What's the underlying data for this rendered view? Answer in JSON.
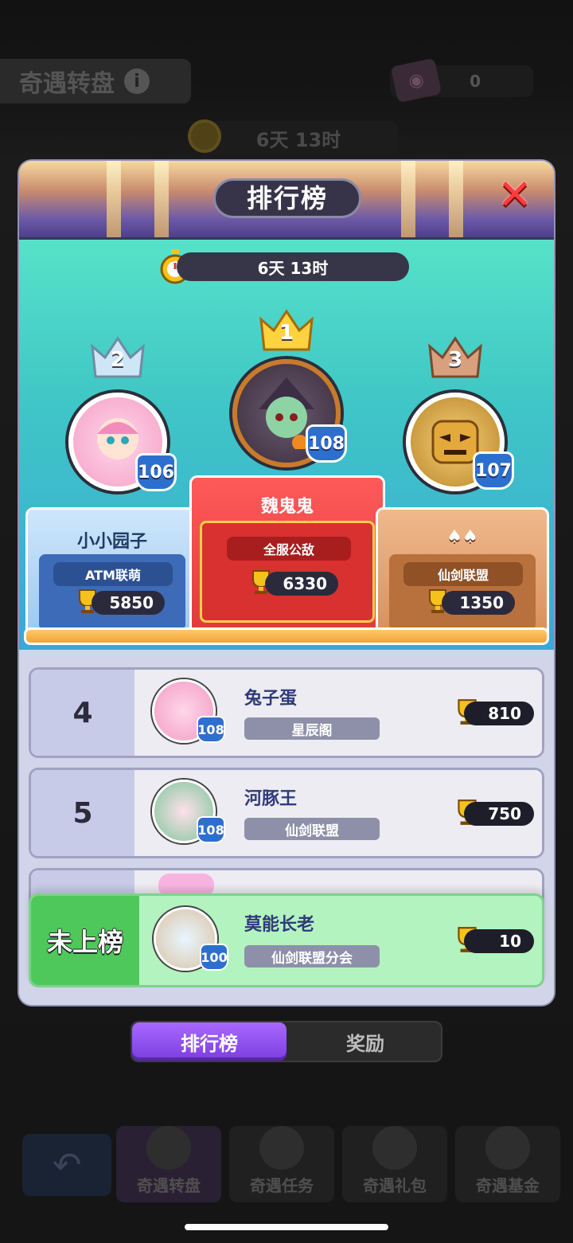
{
  "background": {
    "title": "奇遇转盘",
    "ticket_count": "0",
    "timer": "6天 13时"
  },
  "modal": {
    "title": "排行榜",
    "timer": "6天 13时",
    "podium": [
      {
        "place": "2",
        "name": "小小园子",
        "guild": "ATM联萌",
        "score": "5850",
        "level": "106"
      },
      {
        "place": "1",
        "name": "魏鬼鬼",
        "guild": "全服公敌",
        "score": "6330",
        "level": "108"
      },
      {
        "place": "3",
        "name": "♠♠",
        "guild": "仙剑联盟",
        "score": "1350",
        "level": "107"
      }
    ],
    "list": [
      {
        "rank": "4",
        "name": "兔子蛋",
        "guild": "星辰阁",
        "score": "810",
        "level": "108"
      },
      {
        "rank": "5",
        "name": "河豚王",
        "guild": "仙剑联盟",
        "score": "750",
        "level": "108"
      }
    ],
    "my_entry": {
      "rank": "未上榜",
      "name": "莫能长老",
      "guild": "仙剑联盟分会",
      "score": "10",
      "level": "100"
    }
  },
  "tabs": {
    "leaderboard": "排行榜",
    "rewards": "奖励"
  },
  "bottom_nav": [
    "奇遇转盘",
    "奇遇任务",
    "奇遇礼包",
    "奇遇基金"
  ]
}
